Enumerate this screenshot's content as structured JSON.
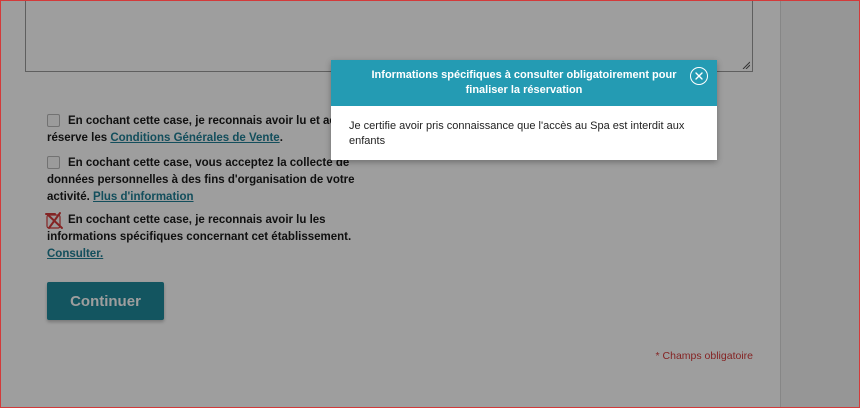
{
  "form": {
    "checkbox1": {
      "text_line1": "En cochant cette case, je reconnais avoir lu et accepté",
      "text_line2_prefix": "réserve les",
      "link": "Conditions Générales de Vente",
      "suffix": "."
    },
    "checkbox2": {
      "text": "En cochant cette case, vous acceptez la collecte de données personnelles à des fins d'organisation de votre activité.",
      "link": "Plus d'information"
    },
    "checkbox3": {
      "text": "En cochant cette case, je reconnais avoir lu les informations spécifiques concernant cet établissement.",
      "link": "Consulter.",
      "state": "error"
    },
    "continue_label": "Continuer",
    "required_note": "* Champs obligatoire"
  },
  "modal": {
    "title": "Informations spécifiques à consulter obligatoirement pour finaliser la réservation",
    "body": "Je certifie avoir pris connaissance que l'accès au Spa est interdit aux enfants",
    "close_icon": "close-circle-icon"
  },
  "colors": {
    "accent": "#249bb3",
    "button": "#1f8a9c",
    "link": "#1f7f95",
    "error": "#d63a3a"
  }
}
